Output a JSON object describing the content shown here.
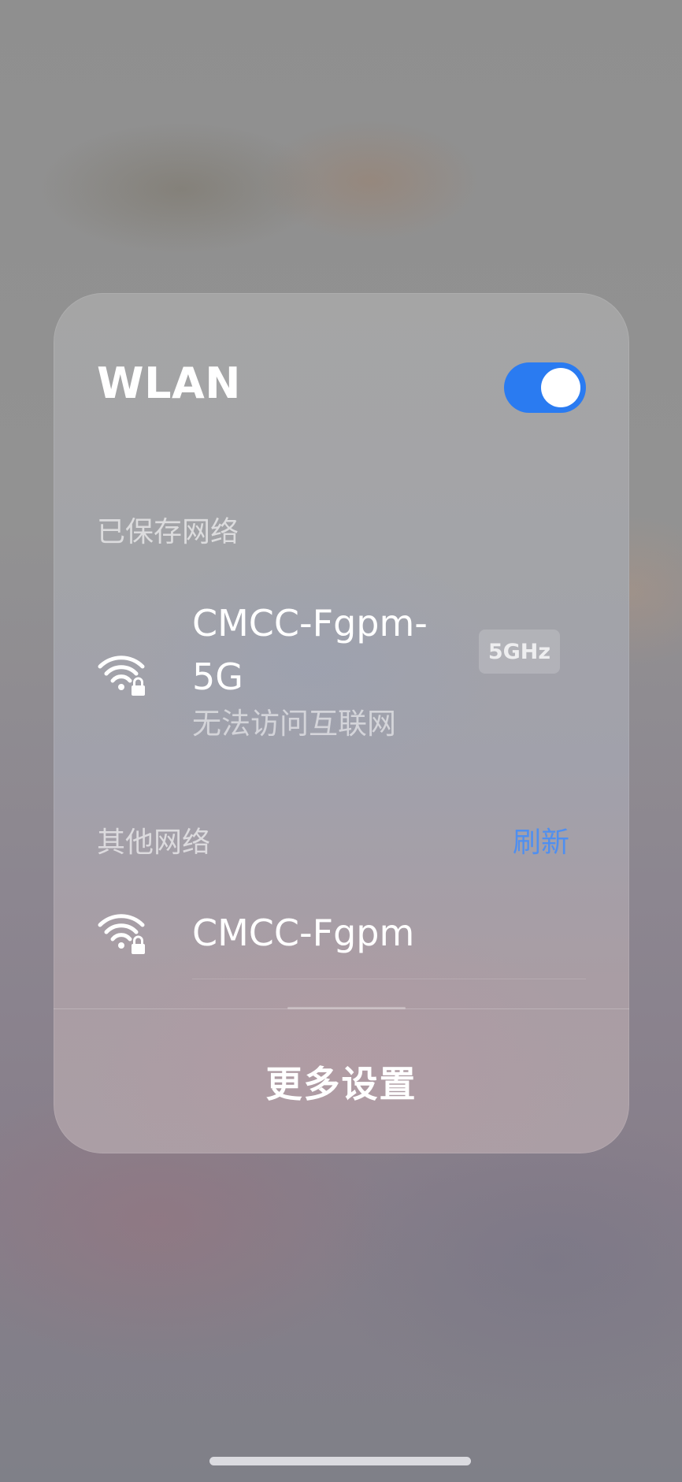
{
  "panel": {
    "title": "WLAN",
    "toggle_on": true,
    "accent_color": "#2a7bf1"
  },
  "saved_networks": {
    "label": "已保存网络",
    "items": [
      {
        "name": "CMCC-Fgpm-5G",
        "status": "无法访问互联网",
        "band": "5GHz",
        "icon": "wifi-lock-icon"
      }
    ]
  },
  "other_networks": {
    "label": "其他网络",
    "refresh_label": "刷新",
    "refresh_color": "#4f8ff0",
    "items": [
      {
        "name": "CMCC-Fgpm",
        "icon": "wifi-lock-icon"
      }
    ]
  },
  "footer": {
    "more_settings_label": "更多设置"
  }
}
